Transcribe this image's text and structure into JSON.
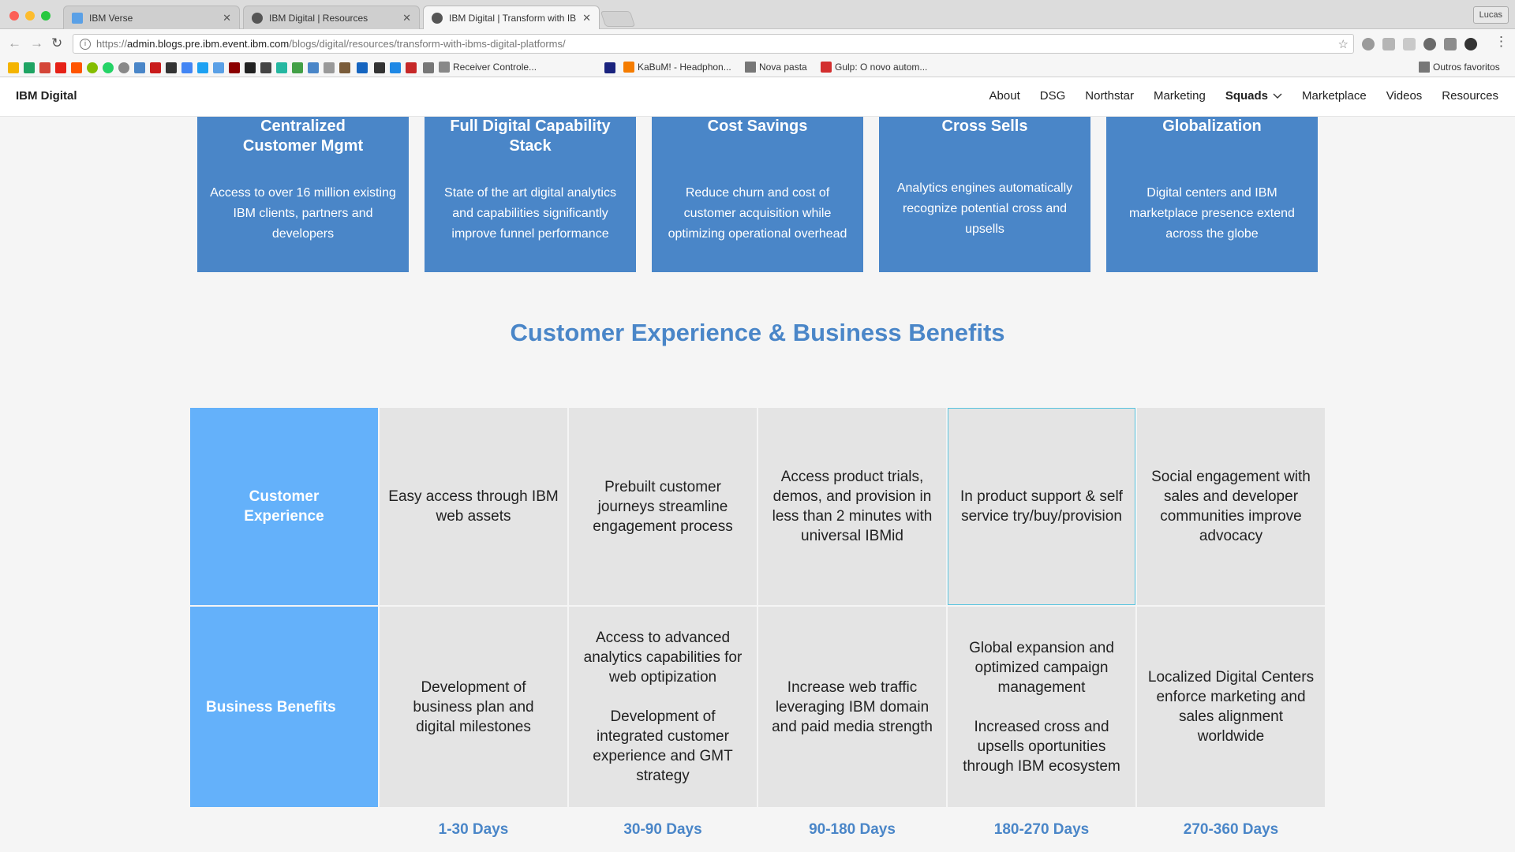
{
  "browser": {
    "tabs": [
      {
        "title": "IBM Verse",
        "icon": "verse-favicon"
      },
      {
        "title": "IBM Digital | Resources",
        "icon": "ibm-favicon"
      },
      {
        "title": "IBM Digital | Transform with IB",
        "icon": "ibm-favicon"
      }
    ],
    "profile": "Lucas",
    "url_prefix": "https://",
    "url_host": "admin.blogs.pre.ibm.event.ibm.com",
    "url_path": "/blogs/digital/resources/transform-with-ibms-digital-platforms/",
    "bookmarks": [
      "Receiver Controle...",
      "KaBuM! - Headphon...",
      "Nova pasta",
      "Gulp: O novo autom..."
    ],
    "other_bookmarks": "Outros favoritos"
  },
  "site": {
    "brand": "IBM Digital",
    "nav": [
      "About",
      "DSG",
      "Northstar",
      "Marketing",
      "Squads",
      "Marketplace",
      "Videos",
      "Resources"
    ]
  },
  "cards": [
    {
      "title": "Centralized Customer Mgmt",
      "desc": "Access to over 16 million existing IBM clients, partners and developers"
    },
    {
      "title": "Full Digital Capability Stack",
      "desc": "State of the art digital analytics and capabilities significantly improve funnel performance"
    },
    {
      "title": "Cost Savings",
      "desc": "Reduce churn and cost of customer acquisition while optimizing operational overhead"
    },
    {
      "title": "Cross Sells",
      "desc": "Analytics engines automatically recognize potential cross and upsells"
    },
    {
      "title": "Globalization",
      "desc": "Digital centers and IBM marketplace presence extend across the globe"
    }
  ],
  "section_title": "Customer Experience & Business Benefits",
  "table": {
    "row_labels": [
      "Customer Experience",
      "Business Benefits"
    ],
    "customer_experience": [
      "Easy access through IBM web assets",
      "Prebuilt customer journeys streamline engagement process",
      "Access product trials, demos, and provision in less than 2 minutes with universal IBMid",
      "In product support & self service try/buy/provision",
      "Social engagement with sales and developer communities improve advocacy"
    ],
    "business_benefits": [
      [
        "Development of business plan and digital milestones"
      ],
      [
        "Access to advanced analytics capabilities for web optipization",
        "Development of integrated customer experience and GMT strategy"
      ],
      [
        "Increase web traffic leveraging IBM domain and paid media strength"
      ],
      [
        "Global expansion and optimized campaign management",
        "Increased cross and upsells oportunities through IBM ecosystem"
      ],
      [
        "Localized Digital Centers enforce marketing and sales alignment worldwide"
      ]
    ],
    "timeline": [
      "1-30 Days",
      "30-90 Days",
      "90-180 Days",
      "180-270 Days",
      "270-360 Days"
    ]
  },
  "colors": {
    "card_blue": "#4a86c8",
    "label_blue": "#64b1fa",
    "cell_gray": "#e4e4e4",
    "title_blue": "#4a86c8"
  }
}
